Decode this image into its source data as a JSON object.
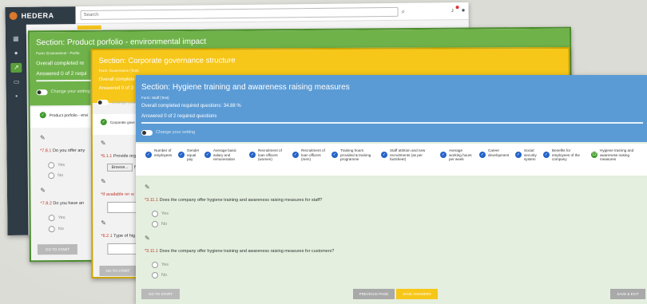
{
  "app": {
    "brand": "HEDERA",
    "search_placeholder": "Search",
    "sidebar_icons": [
      "dashboard-icon",
      "user-icon",
      "chart-icon",
      "id-card-icon",
      "chat-icon"
    ]
  },
  "card_green": {
    "title": "Section: Product porfolio - environmental impact",
    "form": "Form: Environment - Portfo",
    "completed": "Overall completed re",
    "answered": "Answered 0 of 2 requi",
    "toggle_label": "Change your setting",
    "step_label": "Product porfolio - envi",
    "q1_num": "*7.8.1",
    "q1_text": "Do you offer any",
    "q2_num": "*7.8.2",
    "q2_text": "Do you have an",
    "yes": "Yes",
    "no": "No",
    "go_start": "GO TO START"
  },
  "card_yellow": {
    "title": "Section: Corporate governance structure",
    "form": "Form: Governance (Test)",
    "completed": "Overall complete",
    "answered": "Answered 0 of 3",
    "toggle_label": "Change your",
    "step_label": "Corporate gove",
    "q1_num": "*6.1.1",
    "q1_text": "Provide org",
    "browse": "Browse...",
    "browse_no": "No",
    "q2_text": "*If available on w",
    "q3_num": "*6.2.1",
    "q3_text": "Type of hig",
    "go_start": "GO TO START"
  },
  "card_blue": {
    "title": "Section: Hygiene training and awareness raising measures",
    "form": "Form: Staff (Test)",
    "completed": "Overall completed required questions: 34.88 %",
    "answered": "Answered 0 of 2 required questions",
    "toggle_label": "Change your setting",
    "steps": [
      {
        "label": "Number of\nemployees"
      },
      {
        "label": "Gender\nequal\npay"
      },
      {
        "label": "Average basic\nsalary and\nremuneration"
      },
      {
        "label": "Recruitment of\nloan officers\n(women)"
      },
      {
        "label": "Recruitment of\nloan officers\n(men)"
      },
      {
        "label": "Training hours\nprovided & training\nprogramme"
      },
      {
        "label": "Staff attrition and new\nrecruitments (as per\nfactsheet)"
      },
      {
        "label": "Average\nworking hours\nper week"
      },
      {
        "label": "Career\ndevelopment"
      },
      {
        "label": "Social\nsecurity\nsystem"
      },
      {
        "label": "Benefits for\nemployees of the\ncompany"
      },
      {
        "label": "Hygiene training and\nawareness raising\nmeasures"
      }
    ],
    "q1_num": "*3.11.1",
    "q1_text": "Does the company offer hygiene training and awareness raising measures for staff?",
    "q2_num": "*3.11.1",
    "q2_text": "Does the company offer hygiene training and awareness raising measures for customers?",
    "yes": "Yes",
    "no": "No",
    "go_start": "GO TO START",
    "prev": "PREVIOUS PAGE",
    "save_answers": "SAVE ANSWERS",
    "save_exit": "SAVE & EXIT"
  }
}
